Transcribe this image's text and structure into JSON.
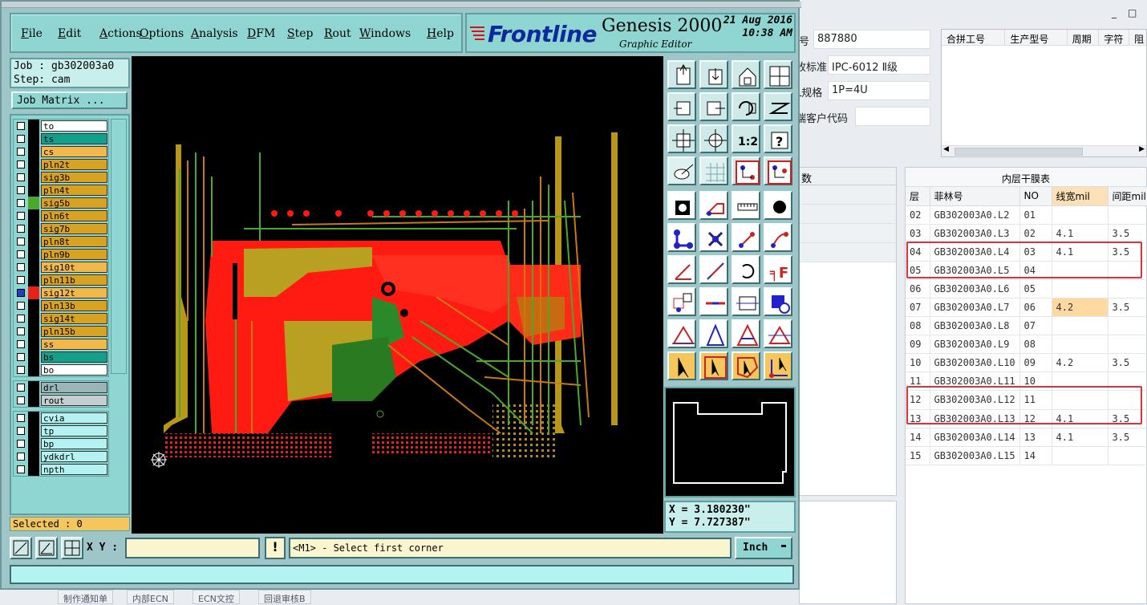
{
  "genesis": {
    "menu": [
      {
        "label": "File",
        "u": "F"
      },
      {
        "label": "Edit",
        "u": "E"
      },
      {
        "label": "Actions",
        "u": "A"
      },
      {
        "label": "Options",
        "u": "O"
      },
      {
        "label": "Analysis",
        "u": "A"
      },
      {
        "label": "DFM",
        "u": "D"
      },
      {
        "label": "Step",
        "u": "S"
      },
      {
        "label": "Rout",
        "u": "R"
      },
      {
        "label": "Windows",
        "u": "W"
      },
      {
        "label": "Help",
        "u": "H"
      }
    ],
    "brand": {
      "logo": "Frontline",
      "product": "Genesis 2000",
      "subtitle": "Graphic Editor",
      "date": "21 Aug 2016",
      "time": "10:38 AM"
    },
    "job_label": "Job : gb302003a0",
    "step_label": "Step: cam",
    "job_matrix_button": "Job Matrix ...",
    "layers_board": [
      {
        "name": "to",
        "color": "#ffffff",
        "mark": "pencil"
      },
      {
        "name": "ts",
        "color": "#12a08c"
      },
      {
        "name": "cs",
        "color": "#f2b84a"
      },
      {
        "name": "pln2t",
        "color": "#d9a220"
      },
      {
        "name": "sig3b",
        "color": "#d9a220"
      },
      {
        "name": "pln4t",
        "color": "#d9a220"
      },
      {
        "name": "sig5b",
        "color": "#d9a220",
        "swatch": "#4aa82a"
      },
      {
        "name": "pln6t",
        "color": "#d9a220"
      },
      {
        "name": "sig7b",
        "color": "#d9a220"
      },
      {
        "name": "pln8t",
        "color": "#d9a220"
      },
      {
        "name": "pln9b",
        "color": "#d9a220"
      },
      {
        "name": "sig10t",
        "color": "#f2b84a"
      },
      {
        "name": "pln11b",
        "color": "#d9a220"
      },
      {
        "name": "sig12t",
        "color": "#f2b84a",
        "swatch": "#e8201a",
        "active": true,
        "mark": "grid"
      },
      {
        "name": "pln13b",
        "color": "#d9a220"
      },
      {
        "name": "sig14t",
        "color": "#d9a220"
      },
      {
        "name": "pln15b",
        "color": "#d9a220"
      },
      {
        "name": "ss",
        "color": "#f2b84a"
      },
      {
        "name": "bs",
        "color": "#12a08c"
      },
      {
        "name": "bo",
        "color": "#ffffff",
        "mark": "pencil"
      }
    ],
    "layers_drill": [
      {
        "name": "drl",
        "color": "#9ab5b8"
      },
      {
        "name": "rout",
        "color": "#c4cdcf"
      }
    ],
    "layers_misc": [
      {
        "name": "cvia",
        "color": "#b4f3f2"
      },
      {
        "name": "tp",
        "color": "#b4f3f2"
      },
      {
        "name": "bp",
        "color": "#b4f3f2"
      },
      {
        "name": "ydkdrl",
        "color": "#b4f3f2"
      },
      {
        "name": "npth",
        "color": "#b4f3f2"
      }
    ],
    "selected": "Selected : 0",
    "coords": {
      "x": "X = 3.180230\"",
      "y": "Y = 7.727387\""
    },
    "xy_label": "X Y :",
    "xy_value": "",
    "warn": "!",
    "prompt": "<M1> - Select first corner",
    "units": "Inch",
    "tools": [
      "open-icon",
      "save-icon",
      "home-icon",
      "window-icon",
      "snap-left-icon",
      "snap-right-icon",
      "undo-icon",
      "layer-icon",
      "fit-icon",
      "zoom-icon",
      "scale-icon",
      "help-icon",
      "measure-icon",
      "grid-icon",
      "net-icon",
      "net2-icon",
      "pad-icon",
      "outline-icon",
      "ruler-icon",
      "dot-icon",
      "connect-icon",
      "cross-icon",
      "add-line-icon",
      "add-arc-icon",
      "angle-icon",
      "draw-icon",
      "rotate-icon",
      "mirror-icon",
      "copy-icon",
      "line-icon",
      "stretch-icon",
      "shape-icon",
      "tri-icon",
      "tri2-icon",
      "tri3-icon",
      "tri4-icon",
      "select-icon",
      "select-box-icon",
      "select-poly-icon",
      "select-net-icon"
    ]
  },
  "erp": {
    "fields": [
      {
        "label": "号",
        "value": "887880"
      },
      {
        "label": "收标准",
        "value": "IPC-6012 Ⅱ级"
      },
      {
        "label": "L规格",
        "value": "1P=4U"
      },
      {
        "label": "端客户代码",
        "value": ""
      }
    ],
    "combine_headers": [
      "合拼工号",
      "生产型号",
      "周期",
      "字符",
      "阻"
    ],
    "mid_header": "数",
    "inner_title": "内层干膜表",
    "inner_headers": [
      "层",
      "菲林号",
      "NO",
      "线宽mil",
      "间距mil"
    ],
    "inner_rows": [
      [
        "02",
        "GB302003A0.L2",
        "01",
        "",
        ""
      ],
      [
        "03",
        "GB302003A0.L3",
        "02",
        "4.1",
        "3.5"
      ],
      [
        "04",
        "GB302003A0.L4",
        "03",
        "4.1",
        "3.5"
      ],
      [
        "05",
        "GB302003A0.L5",
        "04",
        "",
        ""
      ],
      [
        "06",
        "GB302003A0.L6",
        "05",
        "",
        ""
      ],
      [
        "07",
        "GB302003A0.L7",
        "06",
        "4.2",
        "3.5"
      ],
      [
        "08",
        "GB302003A0.L8",
        "07",
        "",
        ""
      ],
      [
        "09",
        "GB302003A0.L9",
        "08",
        "",
        ""
      ],
      [
        "10",
        "GB302003A0.L10",
        "09",
        "4.2",
        "3.5"
      ],
      [
        "11",
        "GB302003A0.L11",
        "10",
        "",
        ""
      ],
      [
        "12",
        "GB302003A0.L12",
        "11",
        "",
        ""
      ],
      [
        "13",
        "GB302003A0.L13",
        "12",
        "4.1",
        "3.5"
      ],
      [
        "14",
        "GB302003A0.L14",
        "13",
        "4.1",
        "3.5"
      ],
      [
        "15",
        "GB302003A0.L15",
        "14",
        "",
        ""
      ]
    ],
    "bottom_tabs": [
      "制作通知单",
      "内部ECN",
      "ECN文控",
      "回退审核B"
    ],
    "window_controls": [
      "_",
      "□"
    ]
  }
}
